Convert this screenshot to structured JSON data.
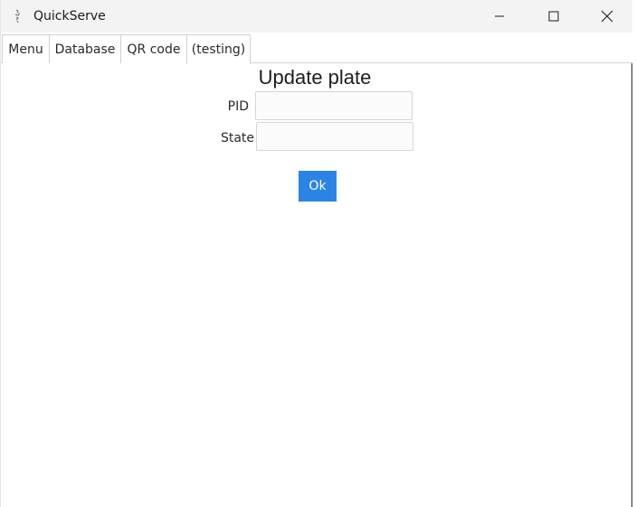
{
  "window": {
    "title": "QuickServe",
    "controls": {
      "minimize_icon": "minimize-icon",
      "maximize_icon": "maximize-icon",
      "close_icon": "close-icon"
    }
  },
  "tabs": [
    {
      "label": "Menu"
    },
    {
      "label": "Database"
    },
    {
      "label": "QR code"
    },
    {
      "label": "(testing)"
    }
  ],
  "form": {
    "heading": "Update plate",
    "pid": {
      "label": "PID",
      "value": "",
      "placeholder": ""
    },
    "state": {
      "label": "State",
      "value": "",
      "placeholder": ""
    },
    "ok_label": "Ok"
  },
  "colors": {
    "accent": "#2a84e7",
    "titlebar": "#f3f3f3"
  }
}
